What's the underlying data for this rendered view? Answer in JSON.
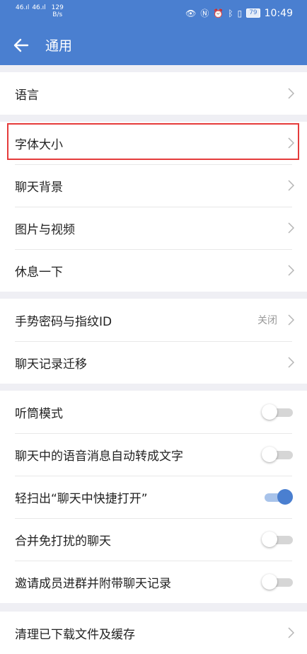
{
  "status_bar": {
    "signal_1": "46",
    "signal_2": "46",
    "net_speed_value": "129",
    "net_speed_unit": "B/s",
    "battery": "79",
    "time": "10:49"
  },
  "header": {
    "title": "通用"
  },
  "groups": [
    {
      "items": [
        {
          "label": "语言"
        }
      ]
    },
    {
      "items": [
        {
          "label": "字体大小"
        },
        {
          "label": "聊天背景"
        },
        {
          "label": "图片与视频"
        },
        {
          "label": "休息一下"
        }
      ]
    },
    {
      "items": [
        {
          "label": "手势密码与指纹ID",
          "value": "关闭"
        },
        {
          "label": "聊天记录迁移"
        }
      ]
    },
    {
      "items": [
        {
          "label": "听筒模式",
          "toggle": false
        },
        {
          "label": "聊天中的语音消息自动转成文字",
          "toggle": false
        },
        {
          "label": "轻扫出“聊天中快捷打开”",
          "toggle": true
        },
        {
          "label": "合并免打扰的聊天",
          "toggle": false
        },
        {
          "label": "邀请成员进群并附带聊天记录",
          "toggle": false
        }
      ]
    },
    {
      "items": [
        {
          "label": "清理已下载文件及缓存"
        }
      ]
    }
  ],
  "colors": {
    "accent": "#4a7fd0",
    "highlight": "#e53b3b",
    "background": "#efeff4"
  },
  "icons": {
    "back": "arrow-left-icon",
    "chevron": "chevron-right-icon"
  }
}
